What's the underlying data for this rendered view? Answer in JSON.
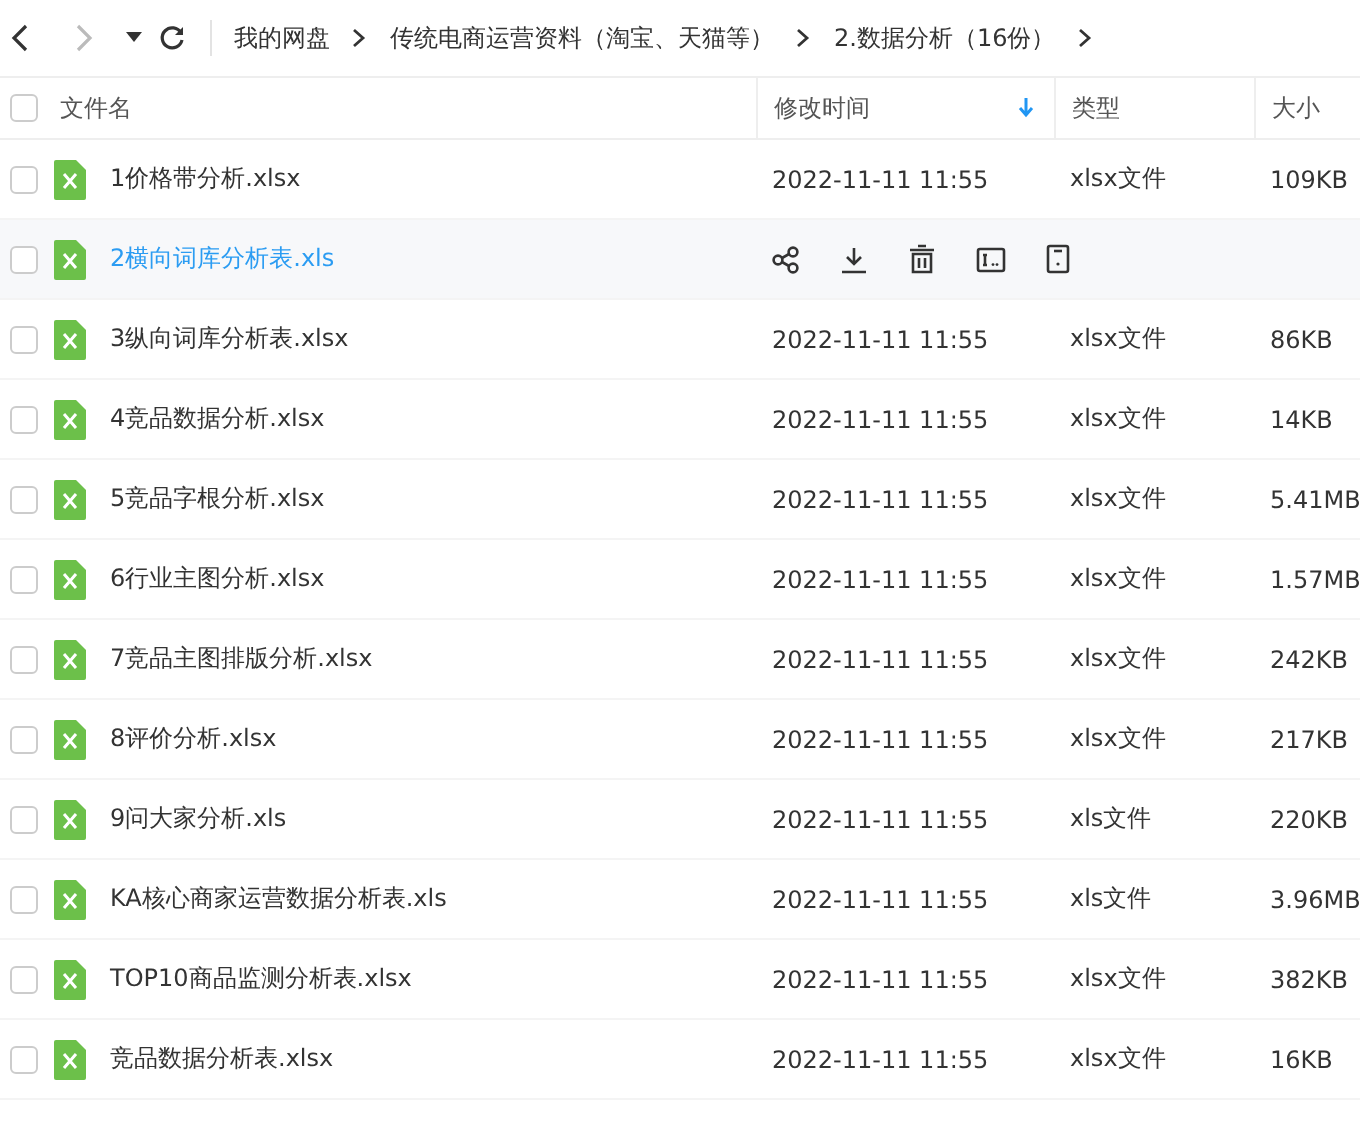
{
  "breadcrumb": [
    "我的网盘",
    "传统电商运营资料（淘宝、天猫等）",
    "2.数据分析（16份）"
  ],
  "table": {
    "select_all": {
      "checked": false
    },
    "columns": [
      {
        "label": "文件名",
        "sorted": false
      },
      {
        "label": "修改时间",
        "sorted": true
      },
      {
        "label": "类型",
        "sorted": false
      },
      {
        "label": "大小",
        "sorted": false
      }
    ],
    "rows": [
      {
        "name": "1价格带分析.xlsx",
        "modified": "2022-11-11 11:55",
        "type": "xlsx文件",
        "size": "109KB",
        "hovered": false
      },
      {
        "name": "2横向词库分析表.xls",
        "hovered": true
      },
      {
        "name": "3纵向词库分析表.xlsx",
        "modified": "2022-11-11 11:55",
        "type": "xlsx文件",
        "size": "86KB",
        "hovered": false
      },
      {
        "name": "4竞品数据分析.xlsx",
        "modified": "2022-11-11 11:55",
        "type": "xlsx文件",
        "size": "14KB",
        "hovered": false
      },
      {
        "name": "5竞品字根分析.xlsx",
        "modified": "2022-11-11 11:55",
        "type": "xlsx文件",
        "size": "5.41MB",
        "hovered": false
      },
      {
        "name": "6行业主图分析.xlsx",
        "modified": "2022-11-11 11:55",
        "type": "xlsx文件",
        "size": "1.57MB",
        "hovered": false
      },
      {
        "name": "7竞品主图排版分析.xlsx",
        "modified": "2022-11-11 11:55",
        "type": "xlsx文件",
        "size": "242KB",
        "hovered": false
      },
      {
        "name": "8评价分析.xlsx",
        "modified": "2022-11-11 11:55",
        "type": "xlsx文件",
        "size": "217KB",
        "hovered": false
      },
      {
        "name": "9问大家分析.xls",
        "modified": "2022-11-11 11:55",
        "type": "xls文件",
        "size": "220KB",
        "hovered": false
      },
      {
        "name": "KA核心商家运营数据分析表.xls",
        "modified": "2022-11-11 11:55",
        "type": "xls文件",
        "size": "3.96MB",
        "hovered": false
      },
      {
        "name": "TOP10商品监测分析表.xlsx",
        "modified": "2022-11-11 11:55",
        "type": "xlsx文件",
        "size": "382KB",
        "hovered": false
      },
      {
        "name": "竞品数据分析表.xlsx",
        "modified": "2022-11-11 11:55",
        "type": "xlsx文件",
        "size": "16KB",
        "hovered": false
      }
    ]
  }
}
